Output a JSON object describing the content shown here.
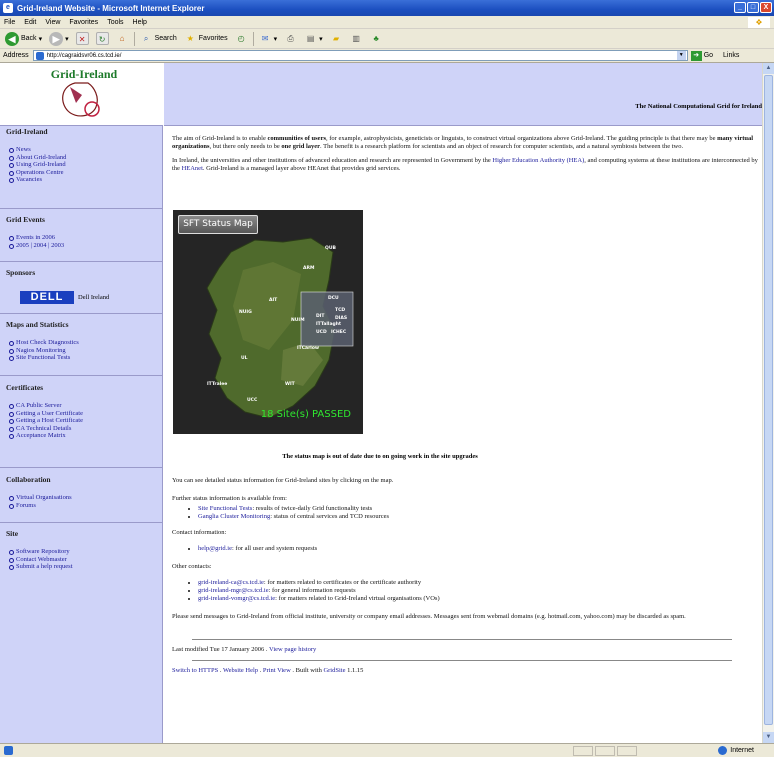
{
  "window": {
    "title": "Grid-Ireland Website - Microsoft Internet Explorer",
    "min": "_",
    "max": "□",
    "close": "X"
  },
  "menu": [
    "File",
    "Edit",
    "View",
    "Favorites",
    "Tools",
    "Help"
  ],
  "toolbar": {
    "back": "Back",
    "search": "Search",
    "favorites": "Favorites"
  },
  "address": {
    "label": "Address",
    "url": "http://cagraidsvr06.cs.tcd.ie/",
    "go": "Go",
    "links": "Links"
  },
  "banner": {
    "tagline": "The National Computational Grid for Ireland"
  },
  "sidebar": {
    "sections": [
      {
        "title": "Grid-Ireland",
        "items": [
          "News",
          "About Grid-Ireland",
          "Using Grid-Ireland",
          "Operations Centre",
          "Vacancies"
        ]
      },
      {
        "title": "Grid Events",
        "items": [
          "Events in 2006",
          "2005 | 2004 | 2003"
        ]
      },
      {
        "title": "Sponsors",
        "items": []
      },
      {
        "title": "Maps and Statistics",
        "items": [
          "Host Check Diagnostics",
          "Nagios Monitoring",
          "Site Functional Tests"
        ]
      },
      {
        "title": "Certificates",
        "items": [
          "CA Public Server",
          "Getting a User Certificate",
          "Getting a Host Certificate",
          "CA Technical Details",
          "Acceptance Matrix"
        ]
      },
      {
        "title": "Collaboration",
        "items": [
          "Virtual Organisations",
          "Forums"
        ]
      },
      {
        "title": "Site",
        "items": [
          "Software Repository",
          "Contact Webmaster",
          "Submit a help request"
        ]
      }
    ],
    "dell_logo": "DELL",
    "dell_text": "Dell Ireland"
  },
  "main": {
    "intro_a": "The aim of Grid-Ireland is to enable ",
    "intro_b": "communities of users",
    "intro_c": ", for example, astrophysicists, geneticists or linguists, to construct virtual organizations above Grid-Ireland. The guiding principle is that there may be ",
    "intro_d": "many virtual organizations",
    "intro_e": ", but there only needs to be ",
    "intro_f": "one grid layer",
    "intro_g": ". The benefit is a research platform for scientists and an object of research for computer scientists, and a natural symbiosis between the two.",
    "inst_a": "In Ireland, the universities and other institutions of advanced education and research are represented in Government by the ",
    "inst_link1": "Higher Education Authority (HEA)",
    "inst_b": ", and computing systems at these institutions are interconnected by the ",
    "inst_link2": "HEAnet",
    "inst_c": ". Grid-Ireland is a managed layer above HEAnet that provides grid services.",
    "map_title": "SFT Status Map",
    "map_status": "18 Site(s) PASSED",
    "map_sites": [
      "QUB",
      "ARM",
      "NUIG",
      "AIT",
      "NUIM",
      "DCU",
      "TCD",
      "DIT",
      "DIAS",
      "ITTallaght",
      "UCD",
      "ICHEC",
      "ITCarlow",
      "UL",
      "ITTralee",
      "WIT",
      "UCC"
    ],
    "map_caption": "The status map is out of date due to on going work in the site upgrades",
    "status_info": "You can see detailed status information for Grid-Ireland sites by clicking on the map.",
    "further": "Further status information is available from:",
    "further_items": [
      {
        "link": "Site Functional Tests",
        "text": ": results of twice-daily Grid functionality tests"
      },
      {
        "link": "Ganglia Cluster Monitoring",
        "text": ": status of central services and TCD resources"
      }
    ],
    "contact": "Contact information:",
    "contact_items": [
      {
        "link": "help@grid.ie",
        "text": ": for all user and system requests"
      }
    ],
    "other": "Other contacts:",
    "other_items": [
      {
        "link": "grid-ireland-ca@cs.tcd.ie",
        "text": ": for matters related to certificates or the certificate authority"
      },
      {
        "link": "grid-ireland-mgr@cs.tcd.ie",
        "text": ": for general information requests"
      },
      {
        "link": "grid-ireland-vomgr@cs.tcd.ie",
        "text": ": for matters related to Grid-Ireland virtual organisations (VOs)"
      }
    ],
    "please": "Please send messages to Grid-Ireland from official institute, university or company email addresses. Messages sent from webmail domains (e.g. hotmail.com, yahoo.com) may be discarded as spam.",
    "modified": "Last modified Tue 17 January 2006 . ",
    "history": "View page history",
    "footer_links": [
      "Switch to HTTPS",
      "Website Help",
      "Print View"
    ],
    "built": " . Built with ",
    "gridsite": "GridSite",
    "version": " 1.1.15"
  },
  "statusbar": {
    "zone": "Internet"
  }
}
